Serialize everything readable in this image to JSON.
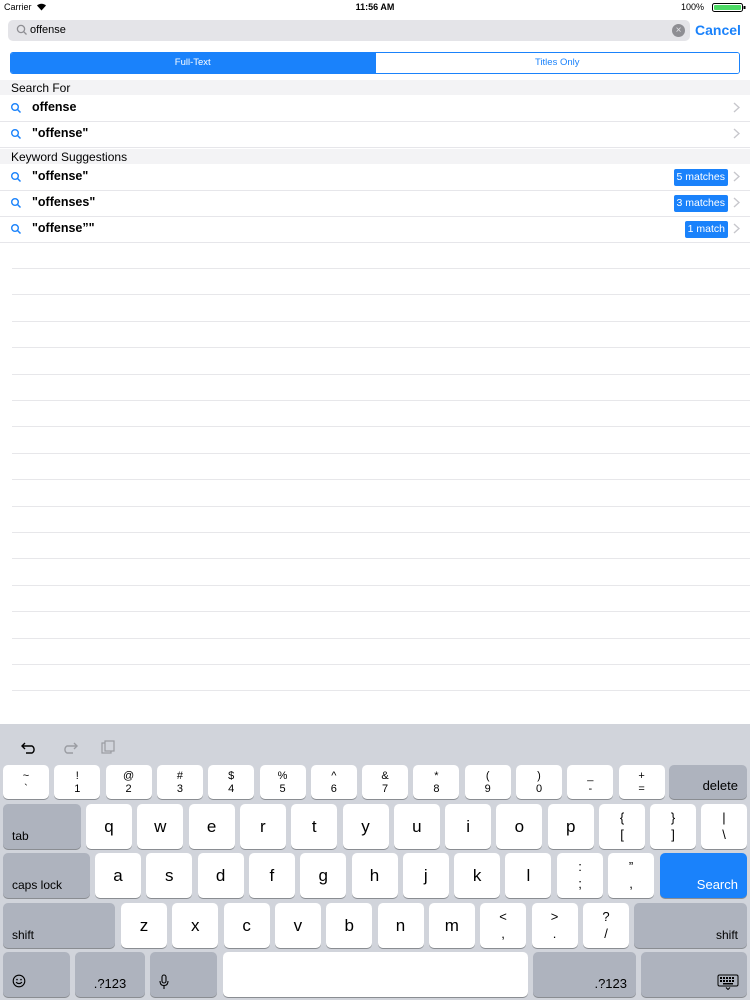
{
  "status_bar": {
    "carrier": "Carrier",
    "time": "11:56 AM",
    "battery": "100%"
  },
  "search": {
    "query": "offense",
    "cancel_label": "Cancel"
  },
  "segments": [
    {
      "label": "Full-Text",
      "selected": true
    },
    {
      "label": "Titles Only",
      "selected": false
    }
  ],
  "sections": [
    {
      "title": "Search For",
      "rows": [
        {
          "text": "offense"
        },
        {
          "text": "\"offense\""
        }
      ]
    },
    {
      "title": "Keyword Suggestions",
      "rows": [
        {
          "text": "\"offense\"",
          "badge": "5 matches"
        },
        {
          "text": "\"offenses\"",
          "badge": "3 matches"
        },
        {
          "text": "\"offense”\"",
          "badge": "1 match"
        }
      ]
    }
  ],
  "keyboard": {
    "number_row": [
      {
        "top": "~",
        "bottom": "`"
      },
      {
        "top": "!",
        "bottom": "1"
      },
      {
        "top": "@",
        "bottom": "2"
      },
      {
        "top": "#",
        "bottom": "3"
      },
      {
        "top": "$",
        "bottom": "4"
      },
      {
        "top": "%",
        "bottom": "5"
      },
      {
        "top": "^",
        "bottom": "6"
      },
      {
        "top": "&",
        "bottom": "7"
      },
      {
        "top": "*",
        "bottom": "8"
      },
      {
        "top": "(",
        "bottom": "9"
      },
      {
        "top": ")",
        "bottom": "0"
      },
      {
        "top": "_",
        "bottom": "-"
      },
      {
        "top": "+",
        "bottom": "="
      }
    ],
    "delete": "delete",
    "tab": "tab",
    "row_q": [
      "q",
      "w",
      "e",
      "r",
      "t",
      "y",
      "u",
      "i",
      "o",
      "p"
    ],
    "row_q_symbols": [
      {
        "top": "{",
        "bottom": "["
      },
      {
        "top": "}",
        "bottom": "]"
      },
      {
        "top": "|",
        "bottom": "\\"
      }
    ],
    "caps_lock": "caps lock",
    "row_a": [
      "a",
      "s",
      "d",
      "f",
      "g",
      "h",
      "j",
      "k",
      "l"
    ],
    "row_a_symbols": [
      {
        "top": ":",
        "bottom": ";"
      },
      {
        "top": "”",
        "bottom": ","
      }
    ],
    "search_key": "Search",
    "shift": "shift",
    "row_z": [
      "z",
      "x",
      "c",
      "v",
      "b",
      "n",
      "m"
    ],
    "row_z_symbols": [
      {
        "top": "<",
        "bottom": ","
      },
      {
        "top": ">",
        "bottom": "."
      },
      {
        "top": "?",
        "bottom": "/"
      }
    ],
    "numbers": ".?123"
  },
  "colors": {
    "accent": "#1a82fb",
    "keyboard_bg": "#d1d4db",
    "special_key": "#aeb3be"
  }
}
